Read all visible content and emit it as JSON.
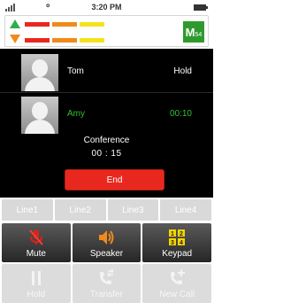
{
  "status_bar": {
    "time": "3:20 PM"
  },
  "quality": {
    "upload_color": "#2fae4e",
    "download_color": "#f08a1c",
    "meter_colors": [
      "#e8281f",
      "#f08a1c",
      "#f5e21b"
    ],
    "mos_letter": "M",
    "mos_value": "54",
    "mos_color": "#2e9a2e"
  },
  "calls": [
    {
      "name": "Tom",
      "status": "Hold",
      "color": "#ffffff"
    },
    {
      "name": "Amy",
      "status": "00:10",
      "color": "#2fc12f"
    }
  ],
  "conference": {
    "label": "Conference",
    "time": "00 : 15"
  },
  "end_button": {
    "label": "End"
  },
  "lines": [
    "Line1",
    "Line2",
    "Line3",
    "Line4"
  ],
  "actions": {
    "mute": {
      "label": "Mute",
      "icon": "mic-muted-icon"
    },
    "speaker": {
      "label": "Speaker",
      "icon": "speaker-icon"
    },
    "keypad": {
      "label": "Keypad",
      "icon": "keypad-icon",
      "digits": [
        "1",
        "2",
        "3",
        "4"
      ]
    },
    "hold": {
      "label": "Hold",
      "icon": "pause-icon"
    },
    "transfer": {
      "label": "Transfer",
      "icon": "transfer-icon"
    },
    "new_call": {
      "label": "New Call",
      "icon": "add-call-icon"
    }
  }
}
